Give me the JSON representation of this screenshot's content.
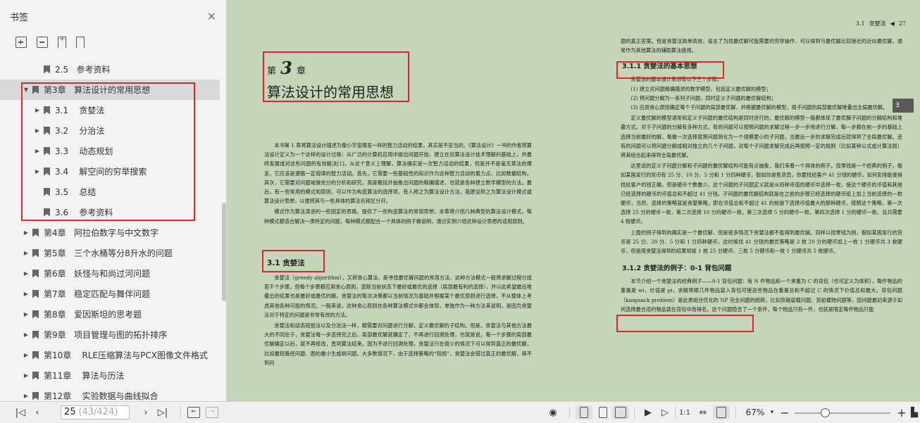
{
  "sidebar": {
    "title": "书签",
    "close_icon": "close-icon",
    "tools": [
      "expand-bookmark-icon",
      "collapse-bookmark-icon",
      "add-bookmark-icon",
      "bookmark-icon"
    ],
    "items": [
      {
        "label": "2.5   参考资料",
        "level": 2,
        "arrow": ""
      },
      {
        "label": "第3章   算法设计的常用思想",
        "level": 1,
        "arrow": "▼"
      },
      {
        "label": "3.1    贪婪法",
        "level": 2,
        "arrow": "▶"
      },
      {
        "label": "3.2    分治法",
        "level": 2,
        "arrow": "▶"
      },
      {
        "label": "3.3    动态规划",
        "level": 2,
        "arrow": "▶"
      },
      {
        "label": "3.4    解空间的穷举搜索",
        "level": 2,
        "arrow": "▶"
      },
      {
        "label": "3.5    总结",
        "level": 2,
        "arrow": ""
      },
      {
        "label": "3.6    参考资料",
        "level": 2,
        "arrow": ""
      },
      {
        "label": "第4章   阿拉伯数字与中文数字",
        "level": 1,
        "arrow": "▶"
      },
      {
        "label": "第5章   三个水桶等分8升水的问题",
        "level": 1,
        "arrow": "▶"
      },
      {
        "label": "第6章   妖怪与和尚过河问题",
        "level": 1,
        "arrow": "▶"
      },
      {
        "label": "第7章   稳定匹配与舞伴问题",
        "level": 1,
        "arrow": "▶"
      },
      {
        "label": "第8章   爱因斯坦的思考题",
        "level": 1,
        "arrow": "▶"
      },
      {
        "label": "第9章   项目管理与图的拓扑排序",
        "level": 1,
        "arrow": "▶"
      },
      {
        "label": "第10章    RLE压缩算法与PCX图像文件格式",
        "level": 1,
        "arrow": "▶"
      },
      {
        "label": "第11章    算法与历法",
        "level": 1,
        "arrow": "▶"
      },
      {
        "label": "第12章    实验数据与曲线拟合",
        "level": 1,
        "arrow": "▶"
      }
    ]
  },
  "left_page": {
    "chapter_prefix": "第",
    "chapter_no": "3",
    "chapter_suffix": "章",
    "chapter_title": "算法设计的常用思想",
    "p1": "本书第 1 章将算法设计描述为像小宇宙爆发一样的智力活动的结果，其实是不妥当的。《算法设计》一书的作者将算法设计定义为一个这样的设计过程：从广泛的计算机应用中提出问题开始，建立在对算法设计技术理解的基础上，并最终发展成对这些问题的有效解决[1]。从这个意义上理解，算法确实是一次智力活动的结果，但是并不是毫无章法的爆发，它应该是遵循一定规律的智力活动。首先，它需要一些基础性的知识作为这种智力活动的着力点，比如数据结构。其次，它需要对问题域做充分的分析和研究，高度概括并抽象出问题的精确描述，也就是各种建立数学模型的方法。最后，有一些常用的模式和原则，可以作为构造算法的选择项，有人称之为算法设计方法，我建议称之为算法设计模式或算法设计思想，以便将其与一些具体的算法名称区分开。",
    "p2": "模式作为算法演进的一些固定的思路，提供了一些构造算法的常用思想，本章将介绍几种典型的算法设计模式，每种模式都适合解决一类特定的问题，每种模式都配合一个具体的例子做说明，通过实例介绍这种设计思想的适用原则。",
    "section_title": "3.1   贪婪法",
    "p3": "贪婪法（greedy algorithm），又称贪心算法，是寻找最优解问题的常用方法，这种方法模式一般将求解过程分成若干个步骤，但每个步骤都应用贪心原则，选取当前状态下最好或最优的选择（局部最有利的选择），并以此希望最后堆叠出的结果也是最好或最优的解。贪婪法的每次决策都以当前情况为基础并根据某个最优原则进行选择，不从整体上考虑其他各种可能的情况。一般来说，这种贪心原则在各种算法模式中都会体现，单独作为一种方法来说明，是因为贪婪法对于特定的问题是非常有效的方法。",
    "p4": "贪婪法和动态规划法以及分治法一样，都需要对问题进行分解，定义最优解的子结构。但是，贪婪法与其他方法最大的不同在于，贪婪法每一步选择完之后，局部最优解就确定了，不再进行回溯处理，也就是说，每一个步骤的局部最优解确定以后，就不再修改，直到算法结束。因为不进行回溯处理，贪婪法只在很少的情况下可以得到真正的最优解，比如最短路径问题、图的最小生成树问题。大多数情况下，由于选择策略的“短视”，贪婪法会错过真正的最优解，得不到问"
  },
  "right_page": {
    "header_section": "3.1",
    "header_title": "贪婪法",
    "header_arrow": "◀",
    "header_page": "27",
    "tab": "3",
    "p0": "题的真正答案。但是贪婪法简单高效，省去了为找最优解可能需要的穷举操作，可以得到与最优解比较接近的近似最优解，通常作为其他算法的辅助算法使用。",
    "sub1": "3.1.1   贪婪法的基本思想",
    "p1": "贪婪法的基本设计思想有以下三个步骤。",
    "s1": "(1) 建立对问题精确描述的数学模型，包括定义最优解的模型；",
    "s2": "(2) 将问题分解为一系列子问题，同时定义子问题的最优解结构；",
    "s3": "(3) 应用贪心原则确定每个子问题的局部最优解，并根据最优解的模型，用子问题的局部最优解堆叠出全局最优解。",
    "p2": "定义最优解的模型通常和定义子问题的最优结构是同时进行的，最优解的模型一般都体现了最优解子问题的分解结构和堆叠方式。对于子问题的分解有多种方式，有的问题可以按照问题的求解过程一步一步地进行分解，每一步都在前一步的基础上选择当前最好的解，每做一次选择就将问题简化为一个规模更小的子问题，当最后一步的求解完成后就得到了全局最优解。还有的问题可以将问题分解成相对独立的几个子问题，对每个子问题求解完成后再按照一定的规则（比如某种公式或计算法则）将其组合起来得到全局最优解。",
    "p3": "这里说的定义子问题分解和子问题的最优解结构可能有点抽象，我们来看一个具体的例子。找零钱是一个经典的例子，假如某国发行的货币有 25 分、10 分、5 分和 1 分四种硬币，假如你是售货员，你要找给客户 41 分钱的硬币，如何安排能使得找给客户的钱正确，但是硬币个数最少。这个问题的子问题定义就是从四种币值的硬币中选择一枚，使这个硬币的币值和其他已经选择的硬币的币值总和不超过 41 分钱。子问题的最优解结构就是在之前的步骤已经选择的硬币组上加上当前选择的一枚硬币，当然，选择的策略就是贪婪策略，即在币值总和不超过 41 的前提下选择币值最大的那种硬币。按照这个策略，第一次选择 25 分的硬币一枚，第二次选择 10 分的硬币一枚，第三次选择 5 分的硬币一枚，第四次选择 1 分的硬币一枚，总共需要 4 枚硬币。",
    "p4": "上面的例子得到的确实是一个最优解，但是很多情况下贪婪法都不能得到最优解。同样以找零钱为例，假如某国发行的货币是 25 分、20 分、5 分和 1 分四种硬币，这时候找 41 分钱的最优策略是 2 枚 20 分的硬币加上一枚 1 分硬币共 3 枚硬币，但是用贪婪法得到的结果却是 1 枚 25 分硬币、三枚 5 分硬币和一枚 1 分硬币共 5 枚硬币。",
    "sub2": "3.1.2   贪婪法的例子：0-1 背包问题",
    "p5": "本节介绍一个贪婪法的经典例子——0-1 背包问题：有 N 件物品和一个承重为 C 的背包（也可定义为体积），每件物品的重量是 wi，价值是 pi，求解将哪几件物品装入背包可使这些物品在重量总和不超过 C 的情况下价值总和最大。背包问题（knapsack problem）是此类组合优化的 NP 完全问题的统称，比如货箱装载问题、货船载物问题等，因问题最初来源于如何选择最合适的物品装在背包中而得名。这个问题隐含了一个条件，每个物品只有一件，也就是限定每件物品只能"
  },
  "bottombar": {
    "page_current": "25",
    "page_total": "(43/424)",
    "zoom": "67%",
    "first_icon": "first-page-icon",
    "prev_icon": "prev-page-icon",
    "next_icon": "next-page-icon",
    "last_icon": "last-page-icon"
  }
}
